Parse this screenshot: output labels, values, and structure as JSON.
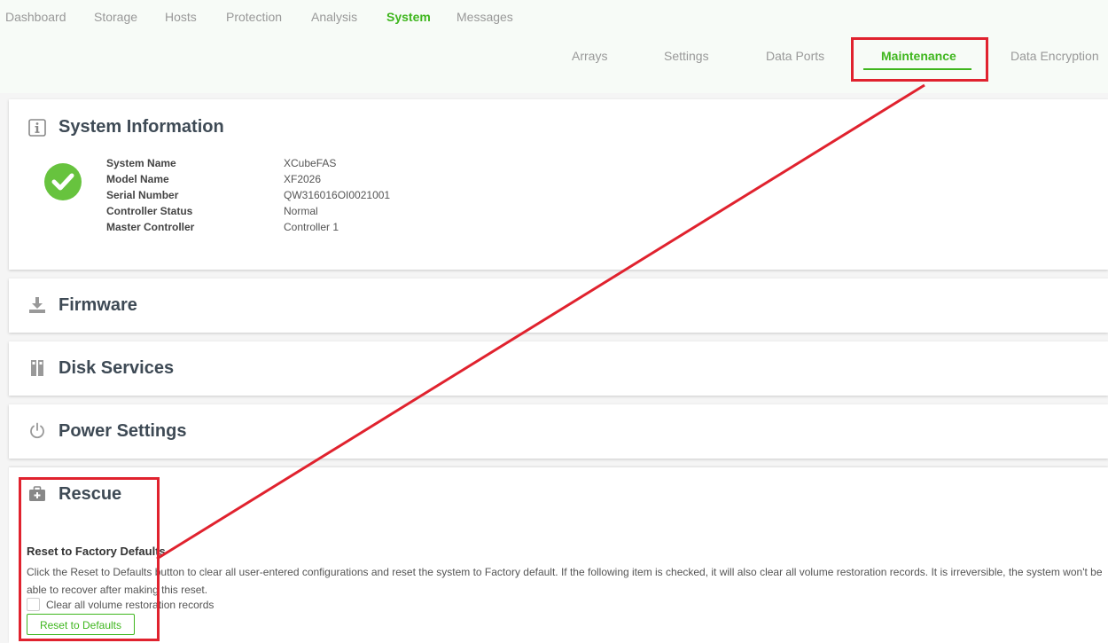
{
  "top_nav": {
    "items": [
      "Dashboard",
      "Storage",
      "Hosts",
      "Protection",
      "Analysis",
      "System",
      "Messages"
    ],
    "active": "System"
  },
  "sub_nav": {
    "items": [
      "Arrays",
      "Settings",
      "Data Ports",
      "Maintenance",
      "Data Encryption"
    ],
    "active": "Maintenance"
  },
  "system_info": {
    "title": "System Information",
    "icon": "info-icon",
    "status_icon": "check-circle-icon",
    "rows": [
      {
        "label": "System Name",
        "value": "XCubeFAS"
      },
      {
        "label": "Model Name",
        "value": "XF2026"
      },
      {
        "label": "Serial Number",
        "value": "QW316016OI0021001"
      },
      {
        "label": "Controller Status",
        "value": "Normal"
      },
      {
        "label": "Master Controller",
        "value": "Controller 1"
      }
    ]
  },
  "firmware": {
    "title": "Firmware",
    "icon": "download-icon"
  },
  "disk_services": {
    "title": "Disk Services",
    "icon": "disk-icon"
  },
  "power_settings": {
    "title": "Power Settings",
    "icon": "power-icon"
  },
  "rescue": {
    "title": "Rescue",
    "icon": "medkit-icon",
    "subtitle": "Reset to Factory Defaults",
    "description": "Click the Reset to Defaults button to clear all user-entered configurations and reset the system to Factory default. If the following item is checked, it will also clear all volume restoration records. It is irreversible, the system won't be able to recover after making this reset.",
    "checkbox_label": "Clear all volume restoration records",
    "checkbox_checked": false,
    "button_label": "Reset to Defaults"
  },
  "colors": {
    "accent": "#3fb61e",
    "annotation": "#e0222e",
    "status_ok": "#67c33e"
  }
}
